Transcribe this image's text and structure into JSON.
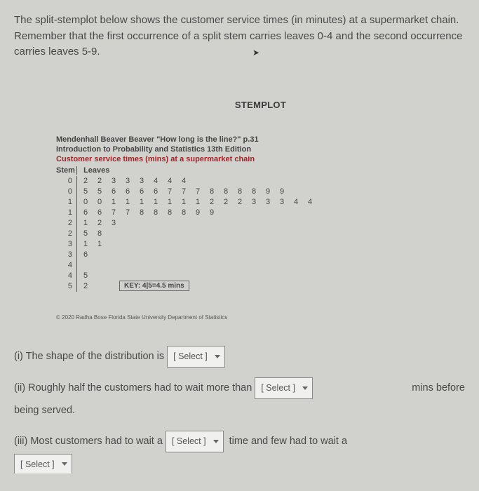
{
  "intro": "The split-stemplot below shows the customer service times (in minutes) at a supermarket chain. Remember that the first occurrence of a split stem carries leaves 0-4 and the second occurrence carries leaves 5-9.",
  "stemplotTitle": "STEMPLOT",
  "source1": "Mendenhall Beaver Beaver \"How long is the line?\" p.31",
  "source2": "Introduction to Probability and Statistics 13th Edition",
  "source3": "Customer service times (mins) at a supermarket chain",
  "headerStem": "Stem",
  "headerLeaves": "Leaves",
  "rows": [
    {
      "stem": "0",
      "leaves": [
        "2",
        "2",
        "3",
        "3",
        "3",
        "4",
        "4",
        "4"
      ]
    },
    {
      "stem": "0",
      "leaves": [
        "5",
        "5",
        "6",
        "6",
        "6",
        "6",
        "7",
        "7",
        "7",
        "8",
        "8",
        "8",
        "8",
        "9",
        "9"
      ]
    },
    {
      "stem": "1",
      "leaves": [
        "0",
        "0",
        "1",
        "1",
        "1",
        "1",
        "1",
        "1",
        "1",
        "2",
        "2",
        "2",
        "3",
        "3",
        "3",
        "4",
        "4"
      ]
    },
    {
      "stem": "1",
      "leaves": [
        "6",
        "6",
        "7",
        "7",
        "8",
        "8",
        "8",
        "8",
        "9",
        "9"
      ]
    },
    {
      "stem": "2",
      "leaves": [
        "1",
        "2",
        "3"
      ]
    },
    {
      "stem": "2",
      "leaves": [
        "5",
        "8"
      ]
    },
    {
      "stem": "3",
      "leaves": [
        "1",
        "1"
      ]
    },
    {
      "stem": "3",
      "leaves": [
        "6"
      ]
    },
    {
      "stem": "4",
      "leaves": []
    },
    {
      "stem": "4",
      "leaves": [
        "5"
      ]
    },
    {
      "stem": "5",
      "leaves": [
        "2"
      ]
    }
  ],
  "key": "KEY: 4|5=4.5 mins",
  "copyright": "© 2020 Radha Bose Florida State University Department of Statistics",
  "q1_prefix": "(i) The shape of the distribution is",
  "q2_prefix": "(ii) Roughly half the customers had to wait more than",
  "q2_suffix1": "mins before",
  "q2_line2": "being served.",
  "q3_prefix": "(iii) Most customers had to wait a",
  "q3_suffix": "time and few had to wait a",
  "selectLabel": "[ Select ]"
}
